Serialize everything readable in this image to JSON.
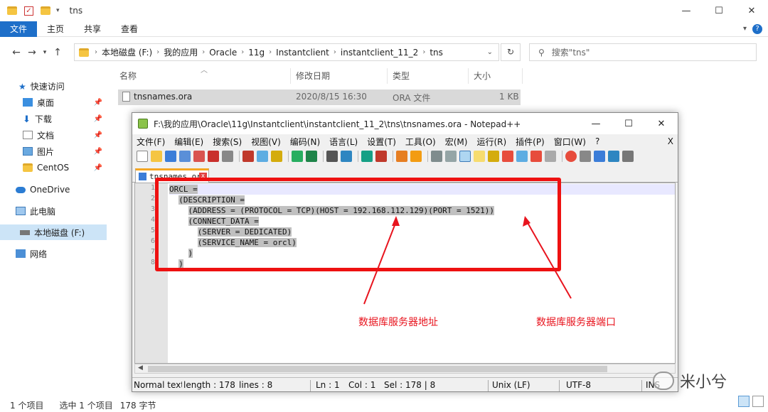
{
  "explorer": {
    "title": "tns",
    "window_controls": {
      "minimize": "—",
      "maximize": "☐",
      "close": "✕"
    },
    "ribbon_tabs": [
      "文件",
      "主页",
      "共享",
      "查看"
    ],
    "ribbon_help": "?",
    "breadcrumbs": [
      "本地磁盘 (F:)",
      "我的应用",
      "Oracle",
      "11g",
      "Instantclient",
      "instantclient_11_2",
      "tns"
    ],
    "search_placeholder": "搜索\"tns\"",
    "sidebar": [
      {
        "label": "快速访问",
        "icon": "star-icon",
        "pinned": false
      },
      {
        "label": "桌面",
        "icon": "desktop-icon",
        "pinned": true
      },
      {
        "label": "下载",
        "icon": "download-icon",
        "pinned": true
      },
      {
        "label": "文档",
        "icon": "document-icon",
        "pinned": true
      },
      {
        "label": "图片",
        "icon": "pictures-icon",
        "pinned": true
      },
      {
        "label": "CentOS",
        "icon": "folder-icon",
        "pinned": true
      },
      {
        "label": "OneDrive",
        "icon": "cloud-icon",
        "pinned": false
      },
      {
        "label": "此电脑",
        "icon": "computer-icon",
        "pinned": false
      },
      {
        "label": "本地磁盘 (F:)",
        "icon": "drive-icon",
        "pinned": false,
        "selected": true
      },
      {
        "label": "网络",
        "icon": "network-icon",
        "pinned": false
      }
    ],
    "columns": {
      "name": "名称",
      "modified": "修改日期",
      "type": "类型",
      "size": "大小"
    },
    "files": [
      {
        "name": "tnsnames.ora",
        "modified": "2020/8/15 16:30",
        "type": "ORA 文件",
        "size": "1 KB"
      }
    ],
    "status": {
      "count": "1 个项目",
      "selected": "选中 1 个项目",
      "bytes": "178 字节"
    }
  },
  "notepad": {
    "title": "F:\\我的应用\\Oracle\\11g\\Instantclient\\instantclient_11_2\\tns\\tnsnames.ora - Notepad++",
    "window_controls": {
      "minimize": "—",
      "maximize": "☐",
      "close": "✕"
    },
    "menu": [
      "文件(F)",
      "编辑(E)",
      "搜索(S)",
      "视图(V)",
      "编码(N)",
      "语言(L)",
      "设置(T)",
      "工具(O)",
      "宏(M)",
      "运行(R)",
      "插件(P)",
      "窗口(W)",
      "?"
    ],
    "menu_close": "X",
    "tab_name": "tnsnames.ora",
    "tab_close": "x",
    "lines": [
      {
        "no": "1",
        "indent": "",
        "text": "ORCL ="
      },
      {
        "no": "2",
        "indent": "  ",
        "text": "(DESCRIPTION ="
      },
      {
        "no": "3",
        "indent": "    ",
        "text": "(ADDRESS = (PROTOCOL = TCP)(HOST = 192.168.112.129)(PORT = 1521))"
      },
      {
        "no": "4",
        "indent": "    ",
        "text": "(CONNECT_DATA ="
      },
      {
        "no": "5",
        "indent": "      ",
        "text": "(SERVER = DEDICATED)"
      },
      {
        "no": "6",
        "indent": "      ",
        "text": "(SERVICE_NAME = orcl)"
      },
      {
        "no": "7",
        "indent": "    ",
        "text": ")"
      },
      {
        "no": "8",
        "indent": "  ",
        "text": ")"
      }
    ],
    "status": {
      "length": "Normal text file",
      "length_value": "length : 178",
      "lines": "lines : 8",
      "ln": "Ln : 1",
      "col": "Col : 1",
      "sel": "Sel : 178 | 8",
      "eol": "Unix (LF)",
      "encoding": "UTF-8",
      "mode": "INS"
    }
  },
  "annotations": {
    "host_label": "数据库服务器地址",
    "port_label": "数据库服务器端口",
    "color": "#e8141e"
  },
  "watermark": {
    "text": "米小兮"
  }
}
